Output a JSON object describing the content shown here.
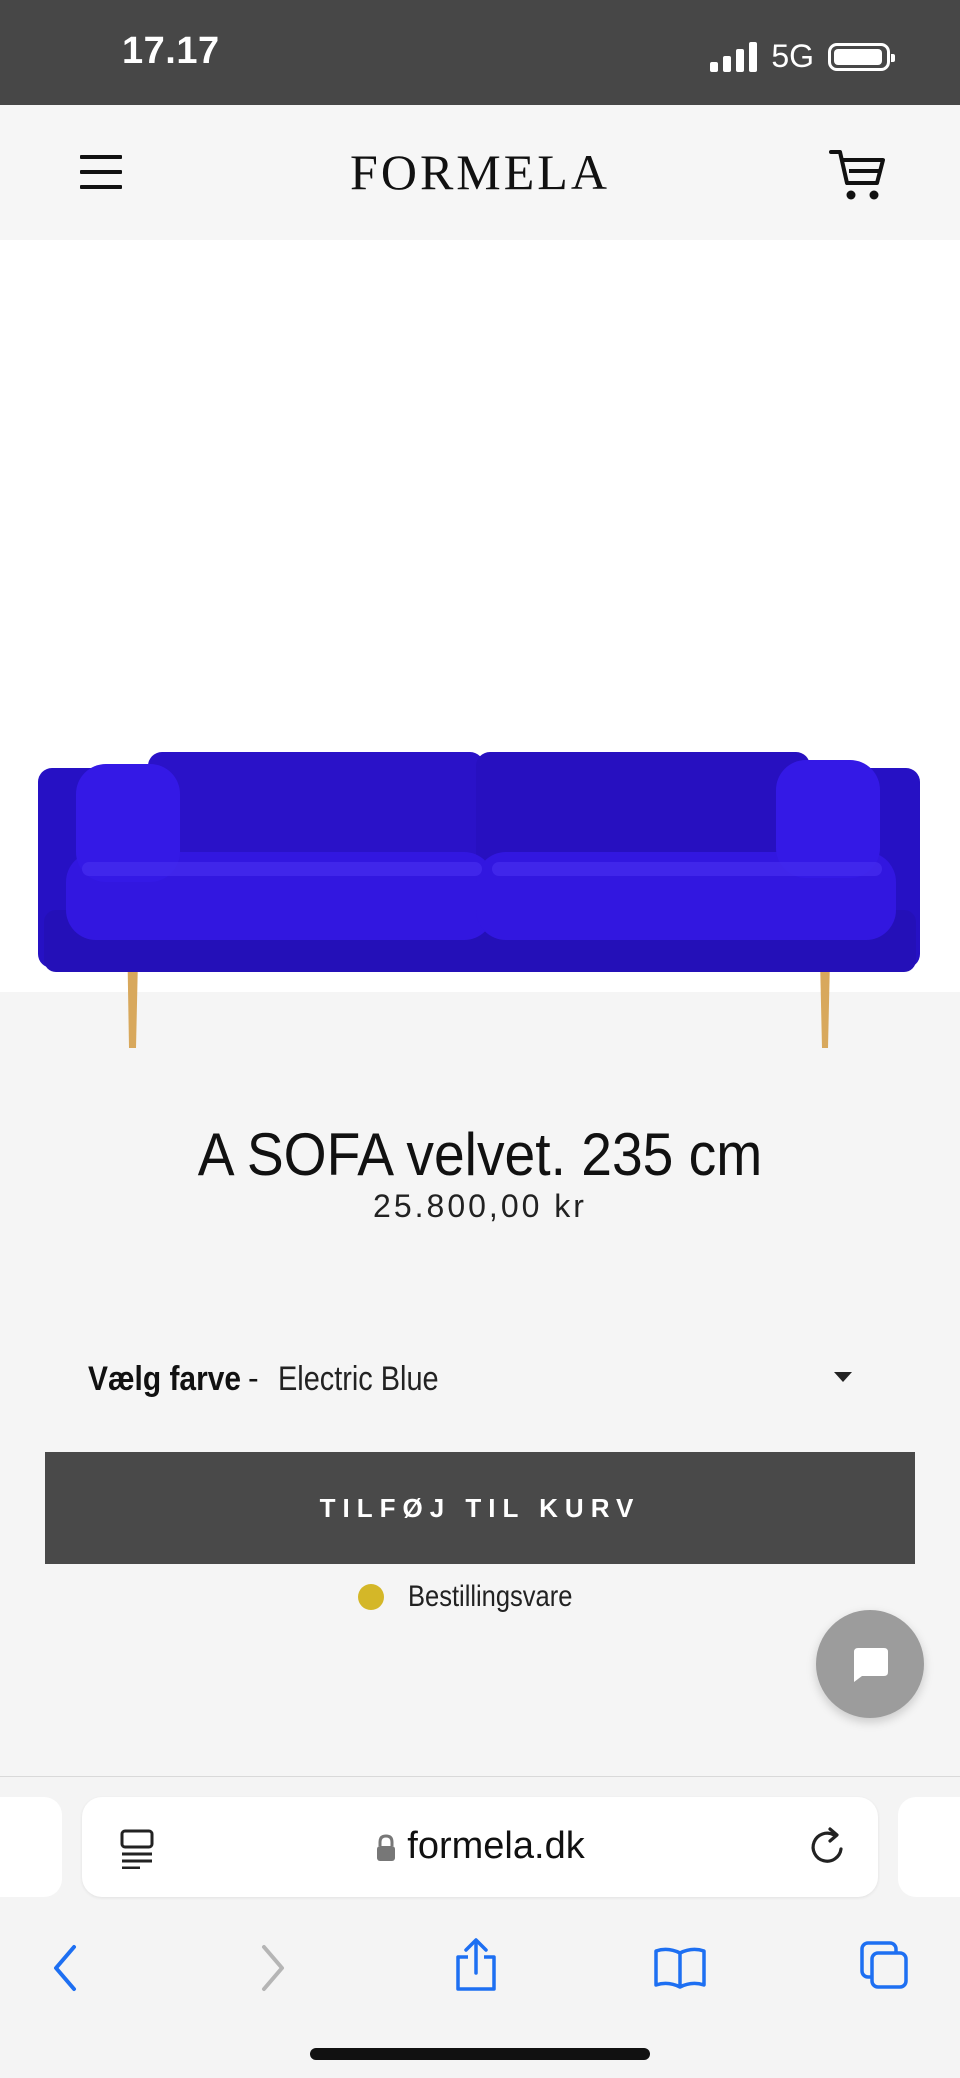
{
  "status_bar": {
    "time": "17.17",
    "network": "5G"
  },
  "header": {
    "brand": "FORMELA",
    "menu_icon": "hamburger-menu-icon",
    "cart_icon": "shopping-cart-icon"
  },
  "product": {
    "title": "A SOFA velvet. 235 cm",
    "price": "25.800,00 kr",
    "color_label": "Vælg farve",
    "color_separator": "-",
    "color_value": "Electric Blue",
    "add_to_cart_label": "TILFØJ TIL KURV",
    "stock_status": "Bestillingsvare",
    "sofa_color": "#2a10d8",
    "stock_color": "#d4b728"
  },
  "browser": {
    "url": "formela.dk"
  }
}
